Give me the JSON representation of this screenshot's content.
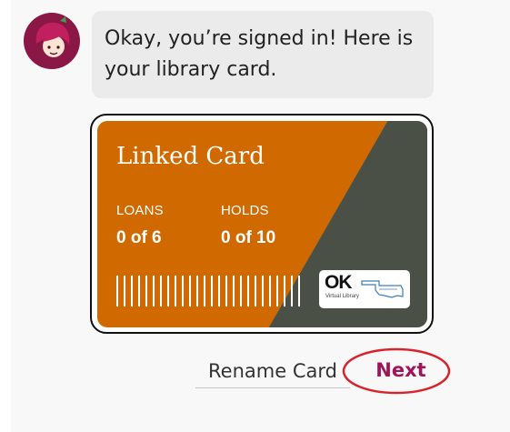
{
  "chat": {
    "message": "Okay, you’re signed in! Here is your library card."
  },
  "card": {
    "title": "Linked Card",
    "loans": {
      "label": "LOANS",
      "value": "0 of 6"
    },
    "holds": {
      "label": "HOLDS",
      "value": "0 of 10"
    },
    "logo": {
      "text": "OK",
      "subtext": "Virtual Library"
    },
    "colors": {
      "primary": "#d06a00",
      "secondary": "#4b5047"
    }
  },
  "actions": {
    "rename_label": "Rename Card",
    "next_label": "Next",
    "next_color": "#a0155a",
    "highlight_color": "#d9232a"
  },
  "icons": {
    "avatar": "libby-avatar-icon",
    "barcode": "barcode-icon",
    "logo": "ok-virtual-library-logo"
  }
}
